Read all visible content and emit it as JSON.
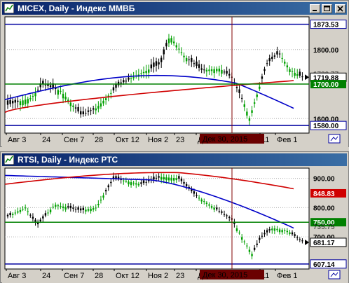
{
  "windows": [
    {
      "title": "MICEX, Daily - Индекс ММВБ",
      "cursor_date": "Дек 30, 2015",
      "x_labels": [
        "Авг 3",
        "24",
        "Сен 7",
        "28",
        "Окт 12",
        "Ноя 2",
        "23",
        "Д",
        "11",
        "Фев 1"
      ],
      "price_labels": [
        {
          "text": "1873.53",
          "style": "boxed-blue"
        },
        {
          "text": "1800.00",
          "style": "plain"
        },
        {
          "text": "1730.77",
          "style": "partial"
        },
        {
          "text": "1719.88",
          "style": "boxed-white"
        },
        {
          "text": "1700.00",
          "style": "boxed-green"
        },
        {
          "text": "1600.00",
          "style": "plain"
        },
        {
          "text": "1580.00",
          "style": "boxed-blue"
        }
      ],
      "levels": {
        "top_line": 1873.53,
        "green_line": 1700.0,
        "bottom_line": 1580.0
      },
      "yrange": [
        1558,
        1895
      ]
    },
    {
      "title": "RTSI, Daily - Индекс РТС",
      "cursor_date": "Дек 30, 2015",
      "x_labels": [
        "Авг 3",
        "24",
        "Сен 7",
        "28",
        "Окт 12",
        "Ноя 2",
        "23",
        "Д",
        "11",
        "Фев 1"
      ],
      "price_labels": [
        {
          "text": "900.00",
          "style": "plain"
        },
        {
          "text": "848.83",
          "style": "boxed-red"
        },
        {
          "text": "800.00",
          "style": "plain"
        },
        {
          "text": "750.00",
          "style": "boxed-green"
        },
        {
          "text": "735.75",
          "style": "partial"
        },
        {
          "text": "700.00",
          "style": "plain"
        },
        {
          "text": "681.17",
          "style": "boxed-white"
        },
        {
          "text": "607.14",
          "style": "boxed-blue"
        }
      ],
      "levels": {
        "top_line": 750.0,
        "bottom_line": 607.14
      },
      "yrange": [
        590,
        935
      ]
    }
  ],
  "colors": {
    "title_start": "#0a246a",
    "title_end": "#3a6ea5",
    "bull": "#00a000",
    "bear": "#000000",
    "ma_fast": "#0000c8",
    "ma_slow": "#d00000",
    "level_green": "#008000",
    "level_blue": "#0000a0",
    "cursor": "#800000"
  }
}
